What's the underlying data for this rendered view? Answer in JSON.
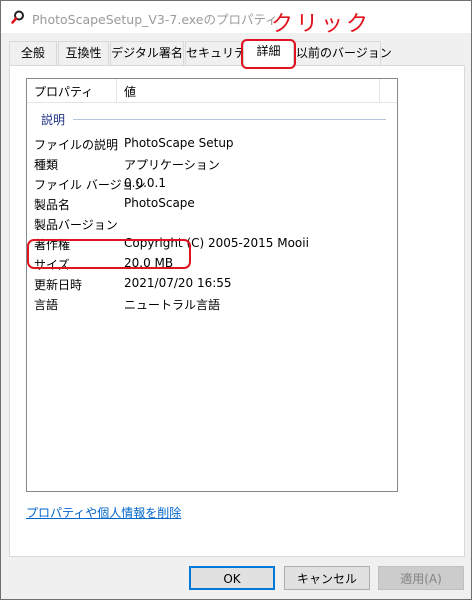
{
  "window": {
    "title": "PhotoScapeSetup_V3-7.exeのプロパティ",
    "icon": "magnifier-app-icon"
  },
  "annotation": {
    "text": "クリック",
    "color": "#e0141e"
  },
  "tabs": [
    {
      "label": "全般",
      "active": false
    },
    {
      "label": "互換性",
      "active": false
    },
    {
      "label": "デジタル署名",
      "active": false
    },
    {
      "label": "セキュリティ",
      "active": false
    },
    {
      "label": "詳細",
      "active": true
    },
    {
      "label": "以前のバージョン",
      "active": false
    }
  ],
  "listview": {
    "columns": [
      "プロパティ",
      "値"
    ],
    "group": "説明",
    "rows": [
      {
        "name": "ファイルの説明",
        "value": "PhotoScape Setup"
      },
      {
        "name": "種類",
        "value": "アプリケーション"
      },
      {
        "name": "ファイル バージョン",
        "value": "0.0.0.1"
      },
      {
        "name": "製品名",
        "value": "PhotoScape"
      },
      {
        "name": "製品バージョン",
        "value": ""
      },
      {
        "name": "著作権",
        "value": "Copyright (C) 2005-2015 Mooii"
      },
      {
        "name": "サイズ",
        "value": "20.0 MB"
      },
      {
        "name": "更新日時",
        "value": "2021/07/20 16:55"
      },
      {
        "name": "言語",
        "value": "ニュートラル言語"
      }
    ]
  },
  "remove_link": "プロパティや個人情報を削除",
  "buttons": {
    "ok": "OK",
    "cancel": "キャンセル",
    "apply": "適用(A)"
  }
}
